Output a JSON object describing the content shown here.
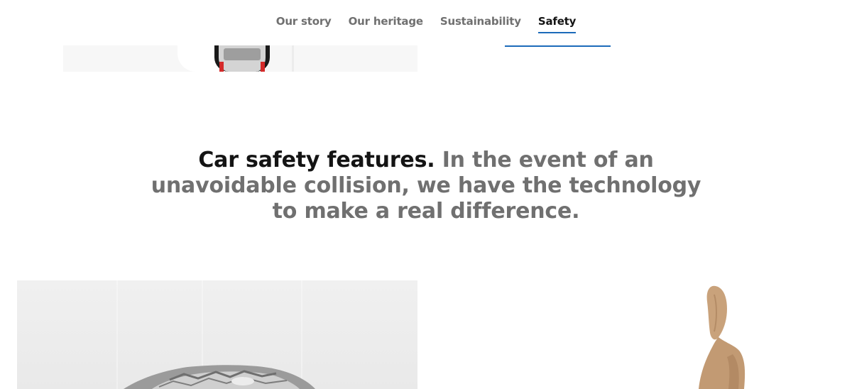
{
  "nav": {
    "tabs": [
      {
        "label": "Our story",
        "active": false
      },
      {
        "label": "Our heritage",
        "active": false
      },
      {
        "label": "Sustainability",
        "active": false
      },
      {
        "label": "Safety",
        "active": true
      }
    ]
  },
  "headline": {
    "lead": "Car safety features.",
    "rest": "In the event of an unavoidable collision, we have the technology to make a real difference."
  },
  "colors": {
    "accent": "#1c6bba",
    "text_primary": "#141414",
    "text_secondary": "#707070",
    "tail_light": "#d42a2a",
    "seat_leather": "#c9a27b"
  }
}
